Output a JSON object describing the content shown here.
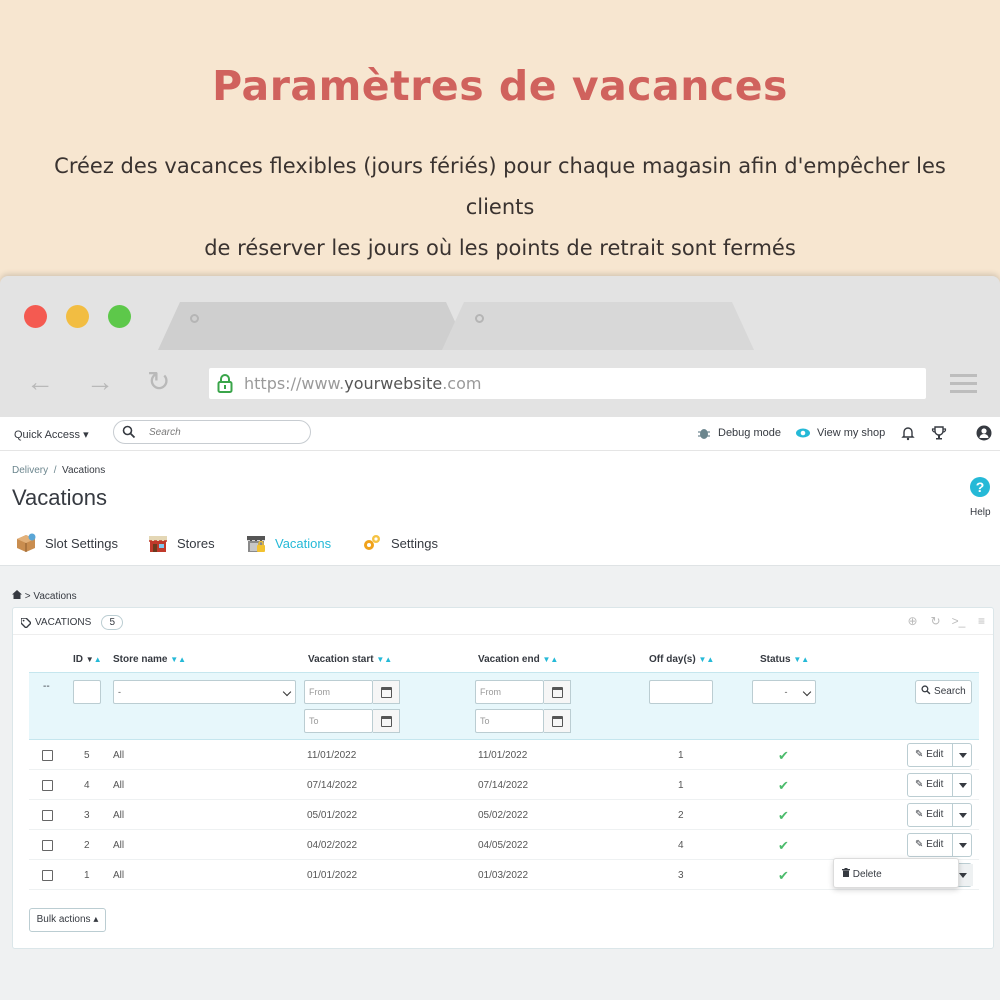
{
  "hero": {
    "title": "Paramètres de vacances",
    "subtitle_line1": "Créez des vacances flexibles (jours fériés) pour chaque magasin afin d'empêcher les clients",
    "subtitle_line2": "de réserver les jours où les points de retrait sont fermés"
  },
  "browser": {
    "url_prefix": "https://www.",
    "url_domain": "yourwebsite",
    "url_suffix": ".com"
  },
  "topbar": {
    "quick_access": "Quick Access",
    "search_placeholder": "Search",
    "debug_mode": "Debug mode",
    "view_shop": "View my shop"
  },
  "header": {
    "breadcrumb_parent": "Delivery",
    "breadcrumb_sep": "/",
    "breadcrumb_current": "Vacations",
    "page_title": "Vacations",
    "help_label": "Help"
  },
  "subtabs": [
    {
      "label": "Slot Settings"
    },
    {
      "label": "Stores"
    },
    {
      "label": "Vacations"
    },
    {
      "label": "Settings"
    }
  ],
  "crumb2": "> Vacations",
  "panel": {
    "title": "Vacations",
    "count": "5"
  },
  "columns": {
    "id": "ID",
    "store": "Store name",
    "start": "Vacation start",
    "end": "Vacation end",
    "off": "Off day(s)",
    "status": "Status"
  },
  "filters": {
    "dash": "--",
    "store_select": "-",
    "from": "From",
    "to": "To",
    "status_select": "-",
    "search_button": "Search"
  },
  "rows": [
    {
      "id": "5",
      "store": "All",
      "start": "11/01/2022",
      "end": "11/01/2022",
      "off": "1"
    },
    {
      "id": "4",
      "store": "All",
      "start": "07/14/2022",
      "end": "07/14/2022",
      "off": "1"
    },
    {
      "id": "3",
      "store": "All",
      "start": "05/01/2022",
      "end": "05/02/2022",
      "off": "2"
    },
    {
      "id": "2",
      "store": "All",
      "start": "04/02/2022",
      "end": "04/05/2022",
      "off": "4"
    },
    {
      "id": "1",
      "store": "All",
      "start": "01/01/2022",
      "end": "01/03/2022",
      "off": "3"
    }
  ],
  "row_actions": {
    "edit": "Edit",
    "delete": "Delete"
  },
  "bulk_actions": "Bulk actions",
  "colors": {
    "accent": "#25b9d7",
    "hero_title": "#d0625d",
    "success": "#4cbb6c"
  }
}
